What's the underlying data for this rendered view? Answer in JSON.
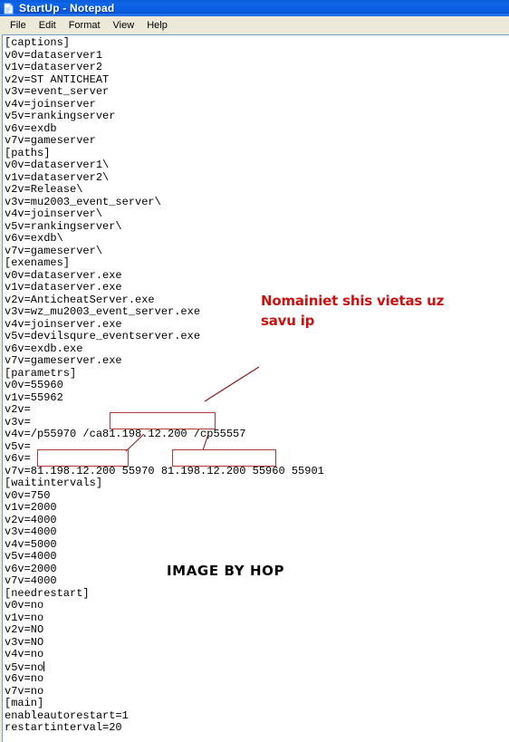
{
  "window": {
    "title": "StartUp - Notepad",
    "icon": "notepad-icon",
    "titlebar_color": "#0a5ce0",
    "menubar_color": "#ece9d8"
  },
  "menu": {
    "items": [
      {
        "label": "File"
      },
      {
        "label": "Edit"
      },
      {
        "label": "Format"
      },
      {
        "label": "View"
      },
      {
        "label": "Help"
      }
    ]
  },
  "document": {
    "filename": "StartUp",
    "lines": [
      "[captions]",
      "v0v=dataserver1",
      "v1v=dataserver2",
      "v2v=ST ANTICHEAT",
      "v3v=event_server",
      "v4v=joinserver",
      "v5v=rankingserver",
      "v6v=exdb",
      "v7v=gameserver",
      "[paths]",
      "v0v=dataserver1\\",
      "v1v=dataserver2\\",
      "v2v=Release\\",
      "v3v=mu2003_event_server\\",
      "v4v=joinserver\\",
      "v5v=rankingserver\\",
      "v6v=exdb\\",
      "v7v=gameserver\\",
      "[exenames]",
      "v0v=dataserver.exe",
      "v1v=dataserver.exe",
      "v2v=AnticheatServer.exe",
      "v3v=wz_mu2003_event_server.exe",
      "v4v=joinserver.exe",
      "v5v=devilsqure_eventserver.exe",
      "v6v=exdb.exe",
      "v7v=gameserver.exe",
      "[parametrs]",
      "v0v=55960",
      "v1v=55962",
      "v2v=",
      "v3v=",
      "v4v=/p55970 /ca81.198.12.200 /cp55557",
      "v5v=",
      "v6v=",
      "v7v=81.198.12.200 55970 81.198.12.200 55960 55901",
      "[waitintervals]",
      "v0v=750",
      "v1v=2000",
      "v2v=4000",
      "v3v=4000",
      "v4v=5000",
      "v5v=4000",
      "v6v=2000",
      "v7v=4000",
      "[needrestart]",
      "v0v=no",
      "v1v=no",
      "v2v=NO",
      "v3v=NO",
      "v4v=no",
      "v5v=no",
      "v6v=no",
      "v7v=no",
      "[main]",
      "enableautorestart=1",
      "restartinterval=20"
    ],
    "caret_line_index": 51,
    "ip_value": "81.198.12.200"
  },
  "annotations": {
    "note_text": "Nomainiet shis vietas uz\nsavu ip",
    "note_color": "#cc1111",
    "watermark_text": "IMAGE BY HOP",
    "watermark_color": "#000000",
    "highlight_box_color": "#b03a3a",
    "highlighted_values": [
      "81.198.12.200",
      "81.198.12.200",
      "81.198.12.200"
    ]
  }
}
